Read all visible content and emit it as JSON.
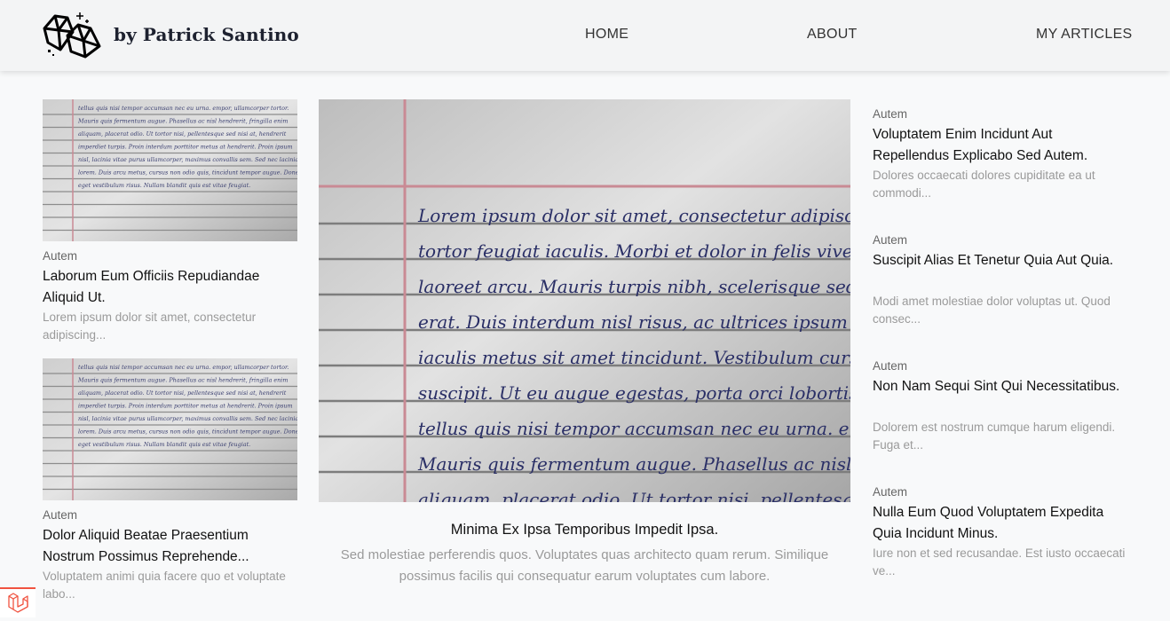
{
  "header": {
    "brand": "by Patrick Santino",
    "logo_icon": "gems-logo-icon",
    "nav": [
      "HOME",
      "ABOUT",
      "MY ARTICLES"
    ]
  },
  "left_cards": [
    {
      "tag": "Autem",
      "title": "Laborum Eum Officiis Repudiandae Aliquid Ut.",
      "excerpt": "Lorem ipsum dolor sit amet, consectetur adipiscing..."
    },
    {
      "tag": "Autem",
      "title": "Dolor Aliquid Beatae Praesentium Nostrum Possimus Reprehende...",
      "excerpt": "Voluptatem animi quia facere quo et voluptate labo..."
    }
  ],
  "hero": {
    "title": "Minima Ex Ipsa Temporibus Impedit Ipsa.",
    "excerpt": "Sed molestiae perferendis quos. Voluptates quas architecto quam rerum. Similique possimus facilis qui consequatur earum voluptates cum labore.",
    "image_lines": [
      "Lorem ipsum dolor sit amet, consectetur adipiscing elit.",
      "tortor feugiat iaculis. Morbi et dolor in felis viverra effi",
      "laoreet arcu. Mauris turpis nibh, scelerisque sed tristiq",
      "erat. Duis interdum nisl risus, ac ultrices ipsum auctor",
      "iaculis metus sit amet tincidunt. Vestibulum cursus urn",
      "suscipit. Ut eu augue egestas, porta orci lobortis, phare",
      "tellus quis nisi tempor accumsan nec eu urna. empor, ul",
      "Mauris quis fermentum augue. Phasellus ac nisl hendre",
      "aliquam, placerat odio. Ut tortor nisi, pellentesque sed"
    ]
  },
  "thumb_lines": [
    "tellus quis nisi tempor accumsan nec eu urna. empor, ullamcorper tortor.",
    "Mauris quis fermentum augue. Phasellus ac nisl hendrerit, fringilla enim",
    "aliquam, placerat odio. Ut tortor nisi, pellentesque sed nisi at, hendrerit",
    "imperdiet turpis. Proin interdum porttitor metus at hendrerit. Proin ipsum",
    "nisl, lacinia vitae purus ullamcorper, maximus convallis sem. Sed nec lacinia",
    "lorem. Duis arcu metus, cursus non odio quis, tincidunt tempor augue. Donec",
    "eget vestibulum risus. Nullam blandit quis est vitae feugiat."
  ],
  "right_cards": [
    {
      "tag": "Autem",
      "title": "Voluptatem Enim Incidunt Aut Repellendus Explicabo Sed Autem.",
      "excerpt": "Dolores occaecati dolores cupiditate ea ut commodi..."
    },
    {
      "tag": "Autem",
      "title": "Suscipit Alias Et Tenetur Quia Aut Quia.",
      "excerpt": "Modi amet molestiae dolor voluptas ut. Quod consec..."
    },
    {
      "tag": "Autem",
      "title": "Non Nam Sequi Sint Qui Necessitatibus.",
      "excerpt": "Dolorem est nostrum cumque harum eligendi. Fuga et..."
    },
    {
      "tag": "Autem",
      "title": "Nulla Eum Quod Voluptatem Expedita Quia Incidunt Minus.",
      "excerpt": "Iure non et sed recusandae. Est iusto occaecati ve..."
    }
  ],
  "colors": {
    "page_bg": "#f8f9fa",
    "header_bg": "#f3f4f5",
    "excerpt": "#9a9a9a",
    "margin_line": "#c98a94",
    "handwriting": "#2a2f66",
    "laravel_red": "#f05340"
  },
  "debug_icon": "laravel-icon"
}
